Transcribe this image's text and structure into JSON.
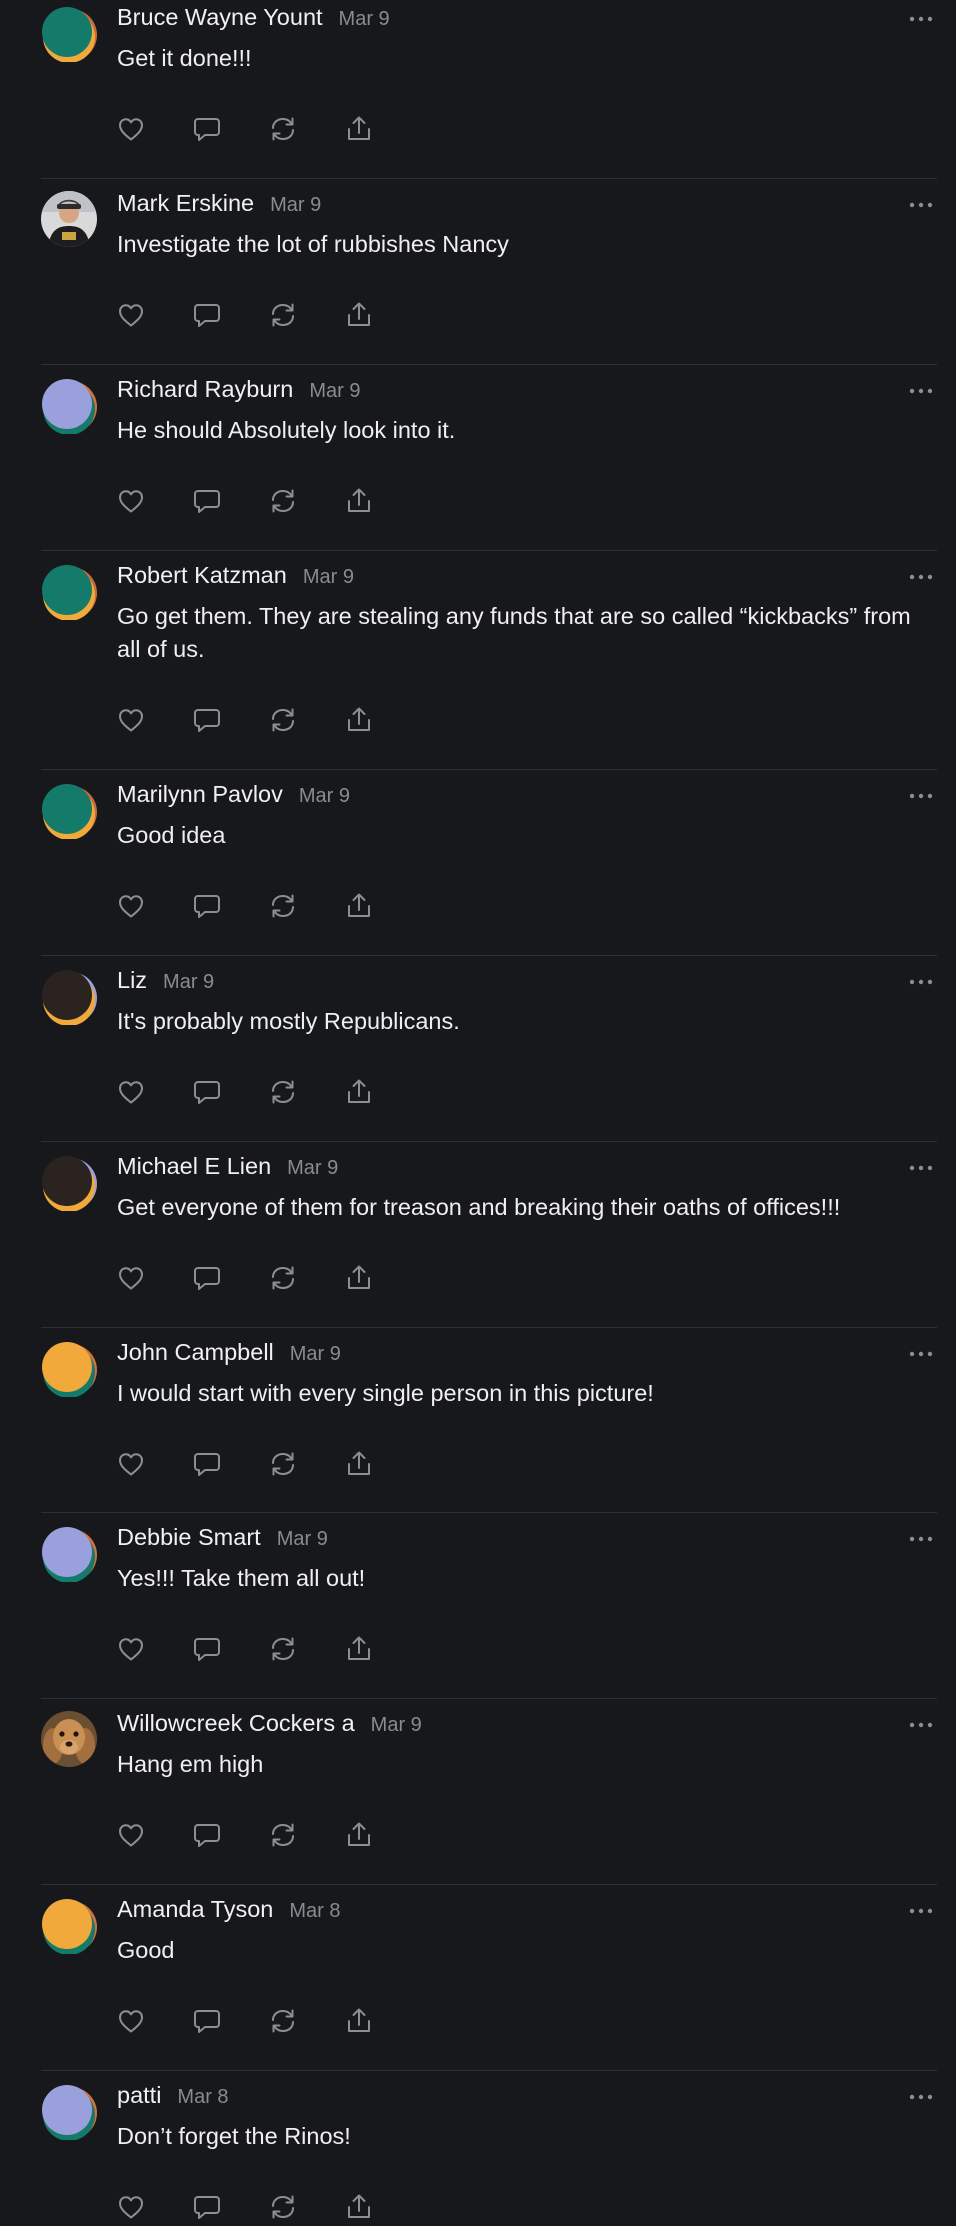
{
  "colors": {
    "background": "#17181b",
    "divider": "#2e2f34",
    "muted": "#8a8b90",
    "icon": "#8d8e93",
    "avatar_teal": "#147a69",
    "avatar_orange": "#f0a93a",
    "avatar_lavender": "#9aa0dc",
    "avatar_dark": "#2a231f"
  },
  "icons": {
    "like": "heart-icon",
    "reply": "speech-bubble-icon",
    "repost": "repost-arrows-icon",
    "share": "share-upload-icon",
    "more": "ellipsis-icon"
  },
  "comments": [
    {
      "author": "Bruce Wayne Yount",
      "date": "Mar 9",
      "text": "Get it done!!!",
      "avatar": "teal"
    },
    {
      "author": "Mark Erskine",
      "date": "Mar 9",
      "text": "Investigate the lot of rubbishes Nancy",
      "avatar": "photo-man"
    },
    {
      "author": "Richard Rayburn",
      "date": "Mar 9",
      "text": "He should Absolutely look into it.",
      "avatar": "lavender"
    },
    {
      "author": "Robert Katzman",
      "date": "Mar 9",
      "text": "Go get them. They are stealing any funds that are so called “kickbacks” from all of us.",
      "avatar": "teal"
    },
    {
      "author": "Marilynn Pavlov",
      "date": "Mar 9",
      "text": "Good idea",
      "avatar": "teal"
    },
    {
      "author": "Liz",
      "date": "Mar 9",
      "text": "It's probably mostly Republicans.",
      "avatar": "dark"
    },
    {
      "author": "Michael E Lien",
      "date": "Mar 9",
      "text": "Get everyone of them for treason and breaking their oaths of offices!!!",
      "avatar": "dark"
    },
    {
      "author": "John Campbell",
      "date": "Mar 9",
      "text": "I would start with every single person in this picture!",
      "avatar": "orange"
    },
    {
      "author": "Debbie Smart",
      "date": "Mar 9",
      "text": "Yes!!! Take them all out!",
      "avatar": "lavender"
    },
    {
      "author": "Willowcreek Cockers a",
      "date": "Mar 9",
      "text": "Hang em high",
      "avatar": "photo-dog"
    },
    {
      "author": "Amanda Tyson",
      "date": "Mar 8",
      "text": "Good",
      "avatar": "orange"
    },
    {
      "author": "patti",
      "date": "Mar 8",
      "text": "Don’t forget the Rinos!",
      "avatar": "lavender"
    }
  ]
}
